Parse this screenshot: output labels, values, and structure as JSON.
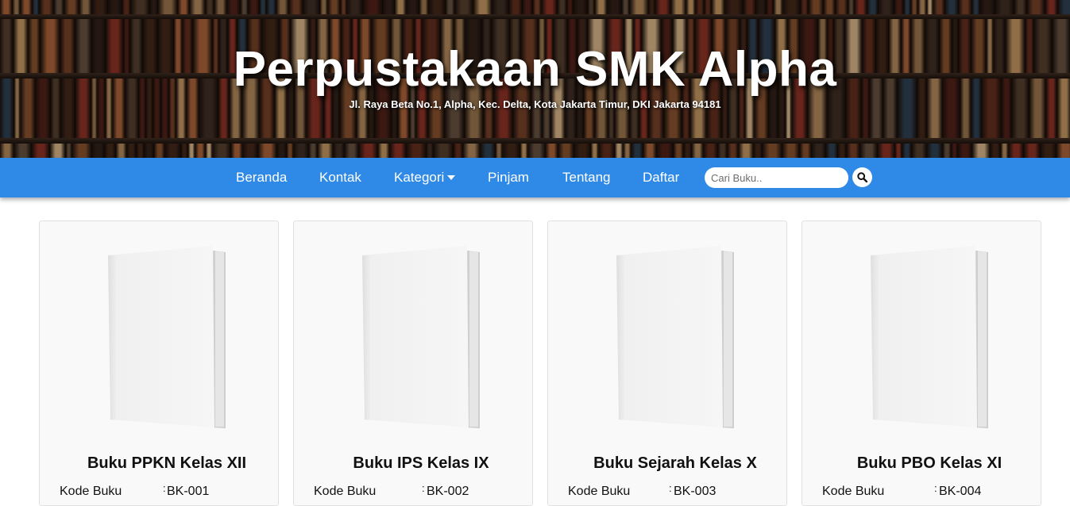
{
  "header": {
    "title": "Perpustakaan SMK Alpha",
    "address": "Jl. Raya Beta No.1, Alpha, Kec. Delta, Kota Jakarta Timur, DKI Jakarta 94181",
    "background": "bookshelf-photo"
  },
  "nav": {
    "items": [
      {
        "label": "Beranda"
      },
      {
        "label": "Kontak"
      },
      {
        "label": "Kategori",
        "icon": "caret-down-icon"
      },
      {
        "label": "Pinjam"
      },
      {
        "label": "Tentang"
      },
      {
        "label": "Daftar"
      }
    ],
    "search": {
      "placeholder": "Cari Buku..",
      "value": "",
      "icon": "search-icon"
    },
    "color": "#2f89e6"
  },
  "books": [
    {
      "title": "Buku PPKN Kelas XII",
      "code_label": "Kode Buku",
      "colon": ":",
      "code": "BK-001"
    },
    {
      "title": "Buku IPS Kelas IX",
      "code_label": "Kode Buku",
      "colon": ":",
      "code": "BK-002"
    },
    {
      "title": "Buku Sejarah Kelas X",
      "code_label": "Kode Buku",
      "colon": ":",
      "code": "BK-003"
    },
    {
      "title": "Buku PBO Kelas XI",
      "code_label": "Kode Buku",
      "colon": ":",
      "code": "BK-004"
    }
  ]
}
